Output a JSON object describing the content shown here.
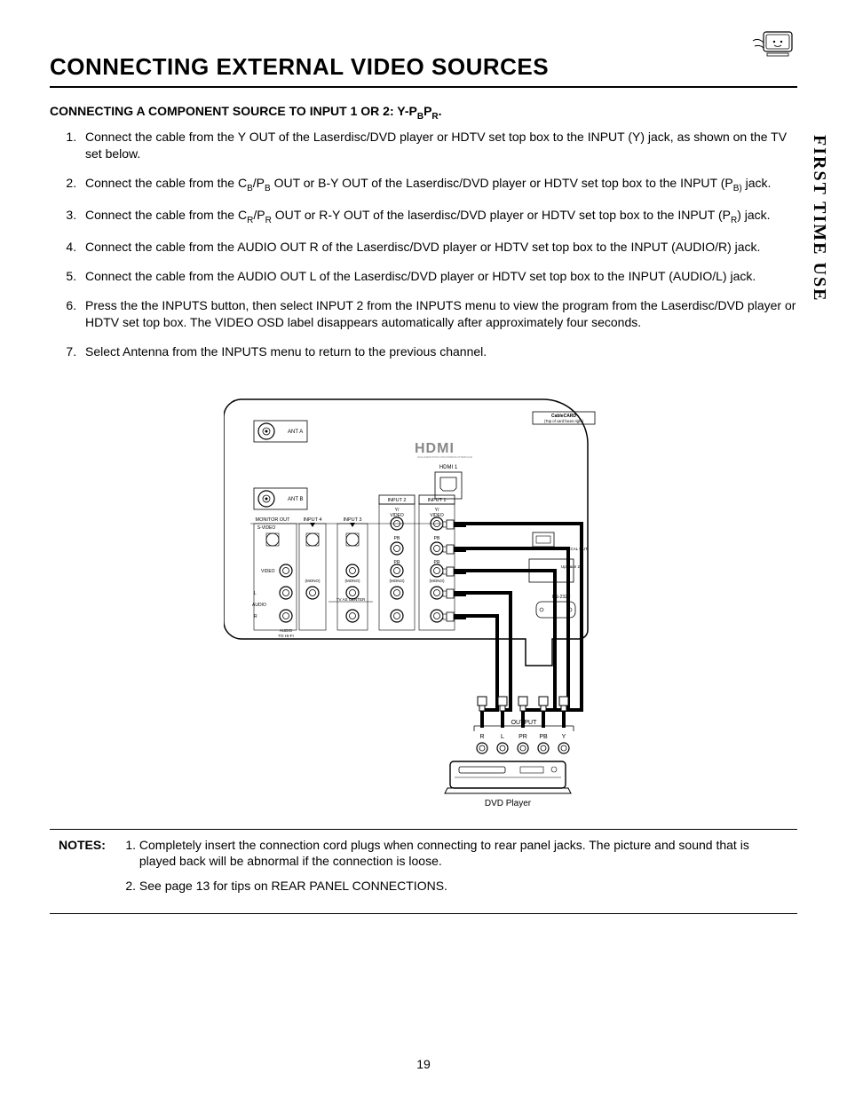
{
  "header": {
    "title": "Connecting External Video Sources",
    "side_tab": "FIRST TIME USE"
  },
  "section": {
    "subtitle_prefix": "CONNECTING A COMPONENT SOURCE TO INPUT 1 OR 2:  Y-P",
    "subtitle_sub1": "B",
    "subtitle_mid": "P",
    "subtitle_sub2": "R",
    "subtitle_suffix": "."
  },
  "steps": [
    {
      "text": "Connect the cable from the Y OUT of the Laserdisc/DVD player or HDTV set top box to the INPUT (Y) jack, as shown on the TV set below."
    },
    {
      "pre": "Connect the cable from the C",
      "s1": "B",
      "mid1": "/P",
      "s2": "B",
      "mid2": " OUT or B-Y OUT of the Laserdisc/DVD  player or HDTV set top box to the INPUT (P",
      "s3": "B)",
      "tail": " jack."
    },
    {
      "pre": "Connect the cable from the C",
      "s1": "R",
      "mid1": "/P",
      "s2": "R",
      "mid2": " OUT or R-Y OUT of the laserdisc/DVD player or HDTV set top box to the INPUT (P",
      "s3": "R",
      "tail": ") jack."
    },
    {
      "text": "Connect the cable from the AUDIO OUT R of the Laserdisc/DVD player or   HDTV set top box to the INPUT (AUDIO/R) jack."
    },
    {
      "text": "Connect the cable from the AUDIO OUT L of the Laserdisc/DVD player or HDTV set top box to the INPUT (AUDIO/L) jack."
    },
    {
      "text": "Press the the INPUTS button, then select INPUT 2 from the INPUTS menu to view the program from the Laserdisc/DVD player or HDTV set top box.  The VIDEO OSD label disappears automatically after approximately four seconds."
    },
    {
      "text": "Select Antenna from the INPUTS menu to return to the previous channel."
    }
  ],
  "diagram": {
    "labels": {
      "cablecard": "CableCARD",
      "cablecard_sub": "(Top of card faces right)",
      "ant_a": "ANT A",
      "ant_b": "ANT B",
      "hdmi": "HDMI 1",
      "input1": "INPUT 1",
      "input2": "INPUT 2",
      "input3": "INPUT 3",
      "input4": "INPUT 4",
      "monitor_out": "MONITOR OUT",
      "y_video": "Y/\nVIDEO",
      "pb": "PB",
      "pr": "PR",
      "mono": "(MONO)",
      "l": "L",
      "r": "R",
      "audio": "AUDIO",
      "audio_to_hifi": "AUDIO\nTO HI-FI",
      "svideo": "S-VIDEO",
      "video": "VIDEO",
      "tv_as_center": "TV AS CENTER",
      "optical": "OPTICAL OUT",
      "rs232c": "RS-232C",
      "upgrade": "Upgrade 2",
      "output": "OUTPUT",
      "dvd_r": "R",
      "dvd_l": "L",
      "dvd_pr": "PR",
      "dvd_pb": "PB",
      "dvd_y": "Y",
      "dvd_player": "DVD Player"
    }
  },
  "notes": {
    "label": "NOTES:",
    "items": [
      "Completely insert the connection cord plugs when connecting to rear panel jacks.  The picture and sound that is played back will be abnormal if the connection is loose.",
      "See page 13 for tips on REAR PANEL CONNECTIONS."
    ]
  },
  "page_number": "19"
}
